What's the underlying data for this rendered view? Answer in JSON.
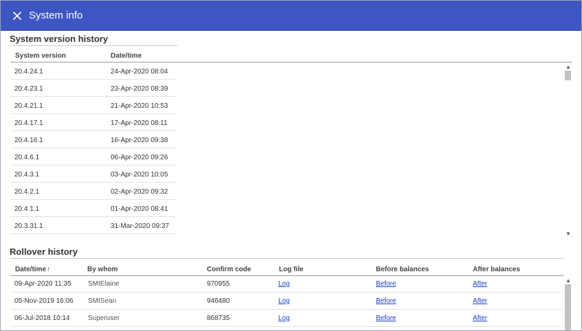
{
  "window": {
    "title": "System info",
    "close_icon": "close-icon"
  },
  "version_history": {
    "title": "System version history",
    "columns": [
      "System version",
      "Date/time"
    ],
    "rows": [
      {
        "version": "20.4.24.1",
        "datetime": "24-Apr-2020 08:04"
      },
      {
        "version": "20.4.23.1",
        "datetime": "23-Apr-2020 08:39"
      },
      {
        "version": "20.4.21.1",
        "datetime": "21-Apr-2020 10:53"
      },
      {
        "version": "20.4.17.1",
        "datetime": "17-Apr-2020 08:11"
      },
      {
        "version": "20.4.16.1",
        "datetime": "16-Apr-2020 09:38"
      },
      {
        "version": "20.4.6.1",
        "datetime": "06-Apr-2020 09:26"
      },
      {
        "version": "20.4.3.1",
        "datetime": "03-Apr-2020 10:05"
      },
      {
        "version": "20.4.2.1",
        "datetime": "02-Apr-2020 09:32"
      },
      {
        "version": "20.4.1.1",
        "datetime": "01-Apr-2020 08:41"
      },
      {
        "version": "20.3.31.1",
        "datetime": "31-Mar-2020 09:37"
      }
    ]
  },
  "rollover_history": {
    "title": "Rollover history",
    "sort_indicator": "↑",
    "columns": [
      "Date/time",
      "By whom",
      "Confirm code",
      "Log file",
      "Before balances",
      "After balances"
    ],
    "rows": [
      {
        "datetime": "09-Apr-2020 11:35",
        "by_whom": "SMIElaine",
        "confirm_code": "970955",
        "log": "Log",
        "before": "Before",
        "after": "After"
      },
      {
        "datetime": "05-Nov-2019 16:06",
        "by_whom": "SMISean",
        "confirm_code": "946480",
        "log": "Log",
        "before": "Before",
        "after": "After"
      },
      {
        "datetime": "06-Jul-2018 10:14",
        "by_whom": "Superuser",
        "confirm_code": "868735",
        "log": "Log",
        "before": "Before",
        "after": "After"
      }
    ]
  },
  "colors": {
    "titlebar": "#3e56c2",
    "link": "#1a3ec9"
  }
}
